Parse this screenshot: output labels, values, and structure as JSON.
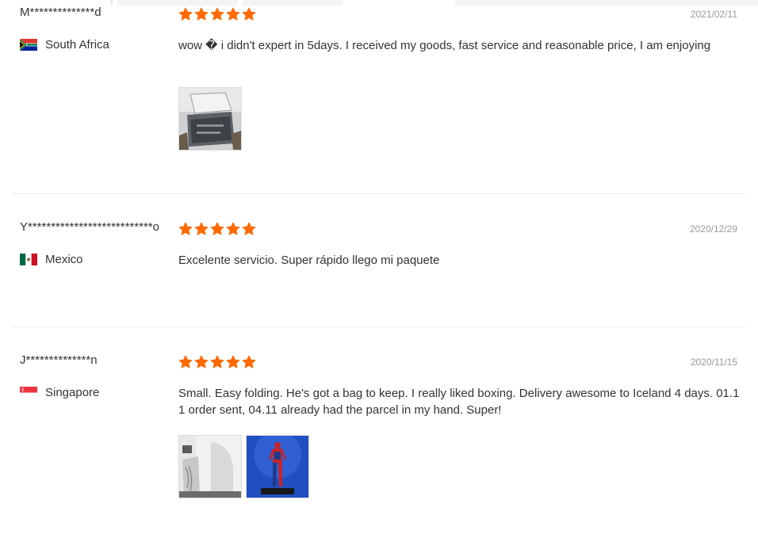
{
  "colors": {
    "star": "#ff6a00",
    "divider": "#ebebeb",
    "date": "#999999",
    "text": "#333333"
  },
  "reviews": [
    {
      "user": "M**************d",
      "country": "South Africa",
      "flag_icon": "south-africa-flag-icon",
      "rating": 5,
      "date": "2021/02/11",
      "text": "wow � i didn't expert in 5days. I received my goods, fast service and reasonable price, I am enjoying",
      "photos": [
        "review-photo-folded-box"
      ]
    },
    {
      "user": "Y***************************o",
      "country": "Mexico",
      "flag_icon": "mexico-flag-icon",
      "rating": 5,
      "date": "2020/12/29",
      "text": "Excelente servicio. Super rápido llego mi paquete",
      "photos": []
    },
    {
      "user": "J**************n",
      "country": "Singapore",
      "flag_icon": "singapore-flag-icon",
      "rating": 5,
      "date": "2020/11/15",
      "text": "Small. Easy folding. He's got a bag to keep. I really liked boxing. Delivery awesome to Iceland 4 days. 01.11 order sent, 04.11 already had the parcel in my hand. Super!",
      "photos": [
        "review-photo-lightbox",
        "review-photo-spiderman-figure"
      ]
    }
  ]
}
